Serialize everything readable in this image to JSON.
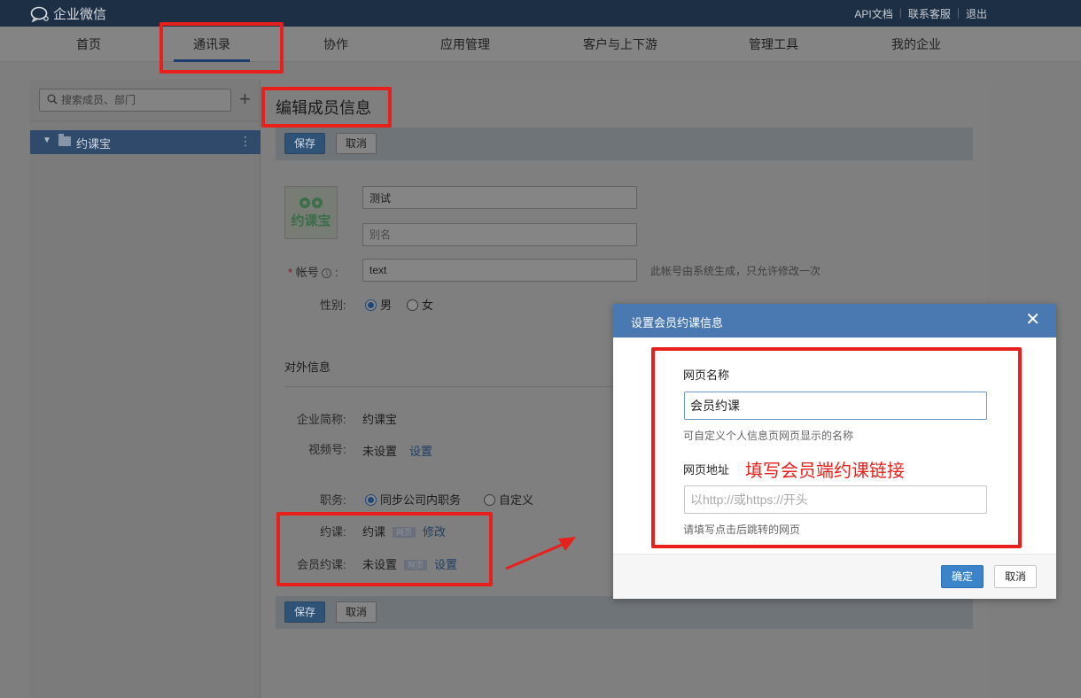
{
  "topbar": {
    "app_title": "企业微信",
    "links": [
      "API文档",
      "联系客服",
      "退出"
    ]
  },
  "nav": {
    "items": [
      {
        "label": "首页",
        "active": false
      },
      {
        "label": "通讯录",
        "active": true
      },
      {
        "label": "协作",
        "active": false
      },
      {
        "label": "应用管理",
        "active": false
      },
      {
        "label": "客户与上下游",
        "active": false
      },
      {
        "label": "管理工具",
        "active": false
      },
      {
        "label": "我的企业",
        "active": false
      }
    ]
  },
  "sidebar": {
    "search_placeholder": "搜索成员、部门",
    "add_icon": "plus-icon",
    "department": "约课宝"
  },
  "main": {
    "title": "编辑成员信息",
    "save_label": "保存",
    "cancel_label": "取消",
    "avatar_text": "约课宝",
    "name_value": "测试",
    "alias_placeholder": "别名",
    "account_label": "帐号",
    "account_value": "text",
    "account_hint": "此帐号由系统生成，只允许修改一次",
    "gender_label": "性别:",
    "gender_options": [
      "男",
      "女"
    ],
    "gender_selected": "男",
    "external_section": "对外信息",
    "company_label": "企业简称:",
    "company_value": "约课宝",
    "channel_label": "视频号:",
    "channel_value": "未设置",
    "channel_link": "设置",
    "position_label": "职务:",
    "position_options": [
      "同步公司内职务",
      "自定义"
    ],
    "course_label": "约课:",
    "course_value": "约课",
    "course_tag": "网页",
    "course_link": "修改",
    "member_course_label": "会员约课:",
    "member_course_value": "未设置",
    "member_course_tag": "网页",
    "member_course_link": "设置"
  },
  "modal": {
    "title": "设置会员约课信息",
    "close_icon": "close-icon",
    "name_label": "网页名称",
    "name_value": "会员约课",
    "name_hint": "可自定义个人信息页网页显示的名称",
    "url_label": "网页地址",
    "url_placeholder": "以http://或https://开头",
    "url_hint": "请填写点击后跳转的网页",
    "annotation": "填写会员端约课链接",
    "ok_label": "确定",
    "cancel_label": "取消"
  },
  "colors": {
    "annotation_red": "#e8201c",
    "modal_header": "#4a79b1",
    "primary_button": "#3b84c9"
  }
}
